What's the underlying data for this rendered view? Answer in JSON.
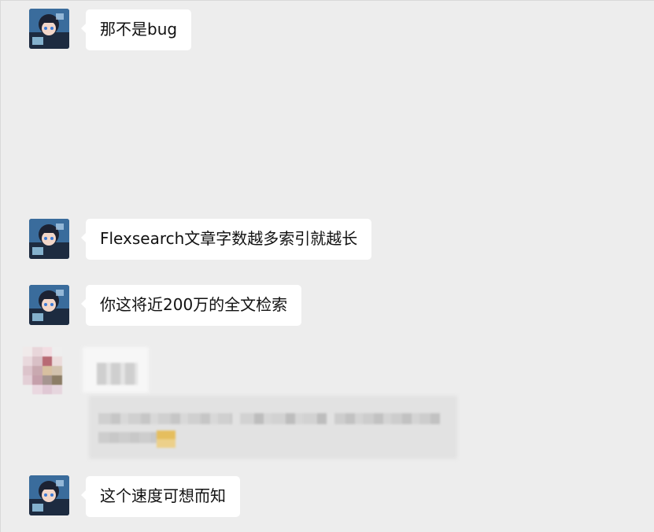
{
  "messages": [
    {
      "text": "那不是bug"
    },
    {
      "text": "Flexsearch文章字数越多索引就越长"
    },
    {
      "text": "你这将近200万的全文检索"
    },
    {
      "text": "这个速度可想而知"
    }
  ],
  "colors": {
    "background": "#ededed",
    "bubble": "#ffffff",
    "text": "#111111"
  },
  "icons": {
    "avatar": "anime-avatar-icon",
    "redacted": "mosaic-redaction"
  }
}
